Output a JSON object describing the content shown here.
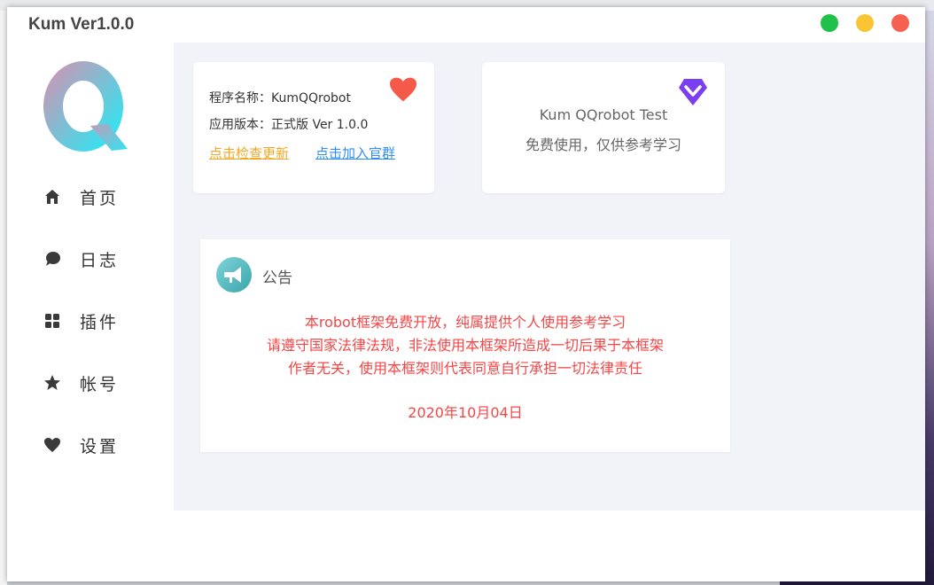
{
  "window": {
    "title": "Kum Ver1.0.0",
    "controls": [
      {
        "name": "maximize",
        "color": "#1fc14a"
      },
      {
        "name": "minimize",
        "color": "#f9c534"
      },
      {
        "name": "close",
        "color": "#f56050"
      }
    ]
  },
  "logo": {
    "letter": "Q",
    "gradient": [
      "#c59ab8",
      "#2fe5f2"
    ]
  },
  "sidebar": {
    "items": [
      {
        "label": "首页",
        "icon": "home-icon"
      },
      {
        "label": "日志",
        "icon": "chat-bubble-icon"
      },
      {
        "label": "插件",
        "icon": "grid-icon"
      },
      {
        "label": "帐号",
        "icon": "star-icon"
      },
      {
        "label": "设置",
        "icon": "heart-icon"
      }
    ]
  },
  "info_card": {
    "program_name": "程序名称：KumQQrobot",
    "version": "应用版本：正式版 Ver 1.0.0",
    "check_update_link": "点击检查更新",
    "join_group_link": "点击加入官群",
    "icon": "heart-icon",
    "colors": {
      "heart": "#f45a4a",
      "update_link": "#f5a623",
      "group_link": "#2f8ef5"
    }
  },
  "test_card": {
    "title": "Kum QQrobot Test",
    "subtitle": "免费使用，仅供参考学习",
    "icon": "diamond-icon",
    "icon_color": "#7b3ff2"
  },
  "notice": {
    "title": "公告",
    "icon": "megaphone-icon",
    "lines": [
      "本robot框架免费开放，纯属提供个人使用参考学习",
      "请遵守国家法律法规，非法使用本框架所造成一切后果于本框架",
      "作者无关，使用本框架则代表同意自行承担一切法律责任"
    ],
    "date": "2020年10月04日",
    "text_color": "#f34747"
  }
}
